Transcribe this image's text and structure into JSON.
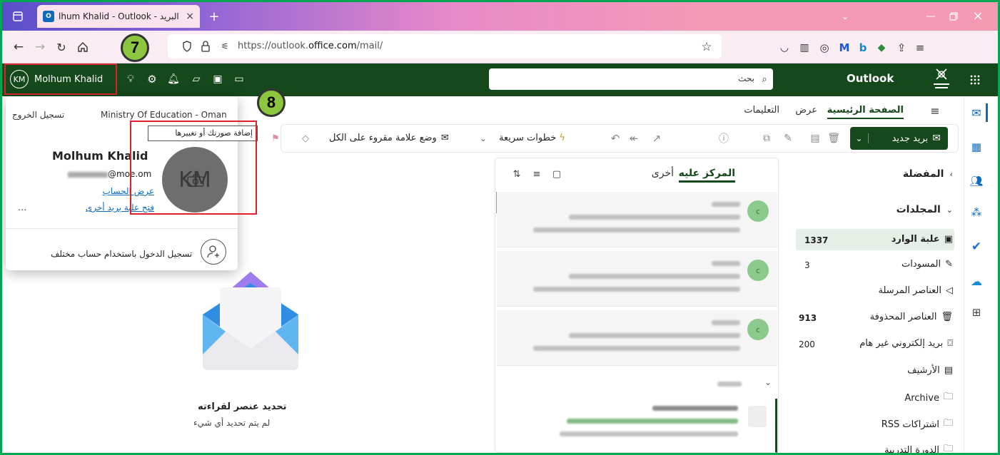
{
  "browser": {
    "tab_title": "Molhum Khalid - Outlook - البريد",
    "tab_title_visible": "lhum Khalid - Outlook - البريد",
    "url_prefix": "https://outlook.",
    "url_domain": "office.com",
    "url_path": "/mail/",
    "new_tab": "+"
  },
  "header": {
    "app_name": "Outlook",
    "search_placeholder": "بحث",
    "account_initials": "KM",
    "account_name": "Molhum Khalid"
  },
  "ribbon": {
    "tabs": [
      "الصفحة الرئيسية",
      "عرض",
      "التعليمات"
    ],
    "new_mail": "بريد جديد",
    "quick_steps": "خطوات سريعة",
    "mark_all_read": "وضع علامة مقروء على الكل"
  },
  "folders": {
    "favorites": "المفضلة",
    "folders_header": "المجلدات",
    "items": [
      {
        "label": "علبة الوارد",
        "count": "1337"
      },
      {
        "label": "المسودات",
        "count": "3"
      },
      {
        "label": "العناصر المرسلة",
        "count": ""
      },
      {
        "label": "العناصر المحذوفة",
        "count": "913"
      },
      {
        "label": "بريد إلكتروني غير هام",
        "count": "200"
      },
      {
        "label": "الأرشيف",
        "count": ""
      },
      {
        "label": "Archive",
        "count": ""
      },
      {
        "label": "اشتراكات RSS",
        "count": ""
      },
      {
        "label": "الدورة التدريبة",
        "count": ""
      }
    ]
  },
  "message_list": {
    "focused": "المركز عليه",
    "other": "أخرى",
    "avatar_letter": "c"
  },
  "reading_pane": {
    "title": "تحديد عنصر لقراءته",
    "subtitle": "لم يتم تحديد أي شيء"
  },
  "account_popup": {
    "org": "Ministry Of Education - Oman",
    "sign_out": "تسجيل الخروج",
    "name": "Molhum Khalid",
    "email_visible": "@moe.om",
    "view_account": "عرض الحساب",
    "open_other_mailbox": "فتح علبة بريد أخرى",
    "more": "...",
    "sign_in_other": "تسجيل الدخول باستخدام حساب مختلف",
    "photo_initials": "KM",
    "tooltip": "إضافة صورتك أو تغييرها"
  },
  "callouts": {
    "first": "7",
    "second": "8"
  },
  "colors": {
    "outlook_green": "#15481a",
    "accent_blue": "#0f6cbd",
    "highlight_red": "#e0202b",
    "callout_green": "#8cc63f",
    "border_green": "#00a651"
  }
}
